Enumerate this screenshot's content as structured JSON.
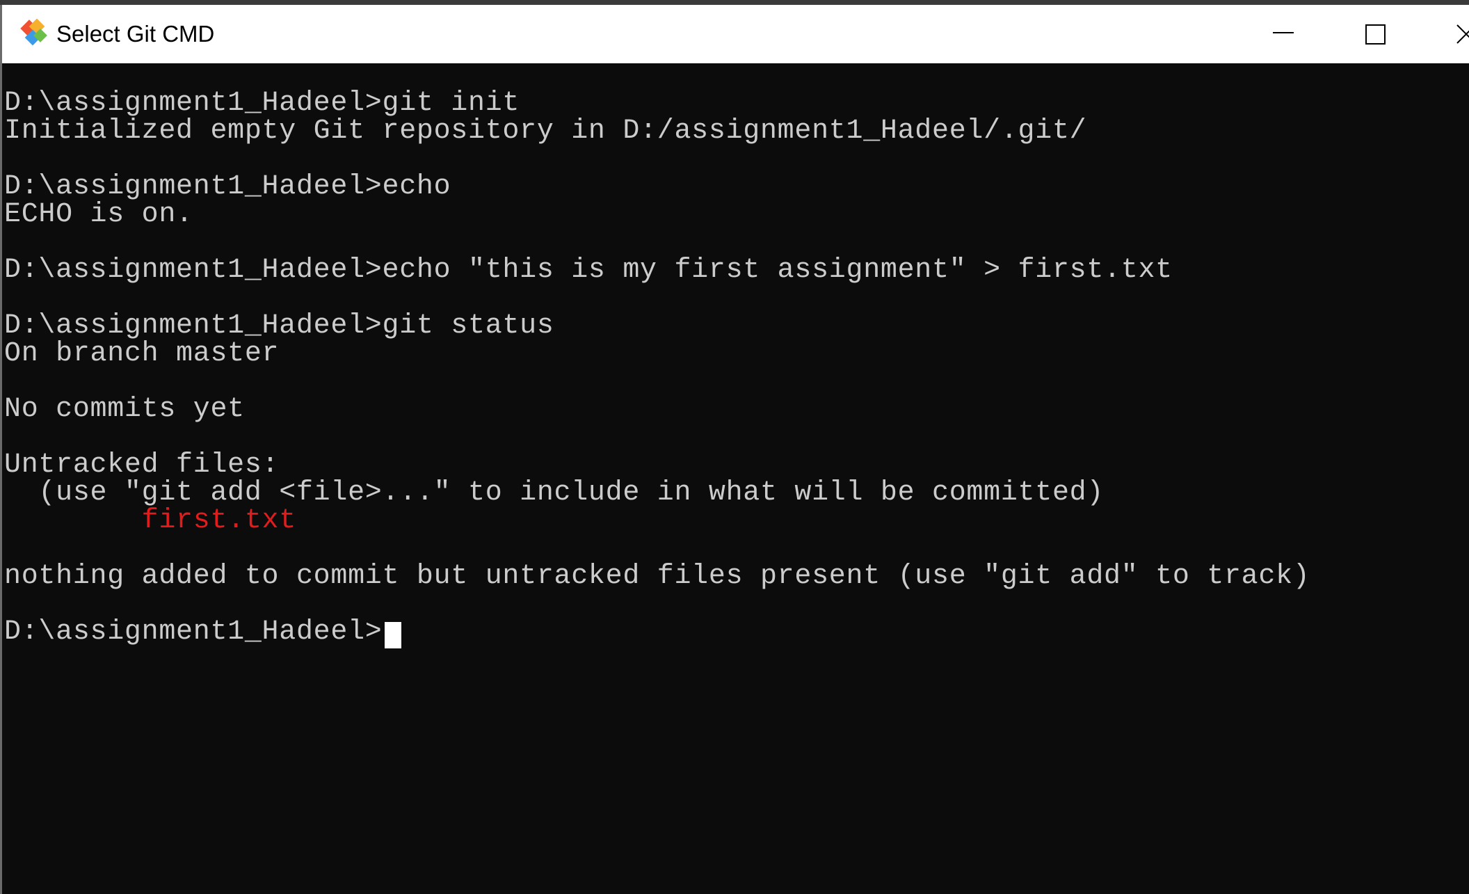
{
  "window": {
    "title": "Select Git CMD",
    "icon": "git-icon",
    "controls": [
      "minimize-icon",
      "maximize-icon",
      "close-icon"
    ]
  },
  "colors": {
    "console_bg": "#0c0c0c",
    "console_text": "#cccccc",
    "untracked_file": "#e21c1c",
    "titlebar_bg": "#ffffff"
  },
  "console": {
    "lines": [
      "D:\\assignment1_Hadeel>git init",
      "Initialized empty Git repository in D:/assignment1_Hadeel/.git/",
      "D:\\assignment1_Hadeel>echo",
      "ECHO is on.",
      "D:\\assignment1_Hadeel>echo \"this is my first assignment\" > first.txt",
      "D:\\assignment1_Hadeel>git status",
      "On branch master",
      "No commits yet",
      "Untracked files:",
      "  (use \"git add <file>...\" to include in what will be committed)",
      "        first.txt",
      "nothing added to commit but untracked files present (use \"git add\" to track)",
      "D:\\assignment1_Hadeel>"
    ]
  }
}
